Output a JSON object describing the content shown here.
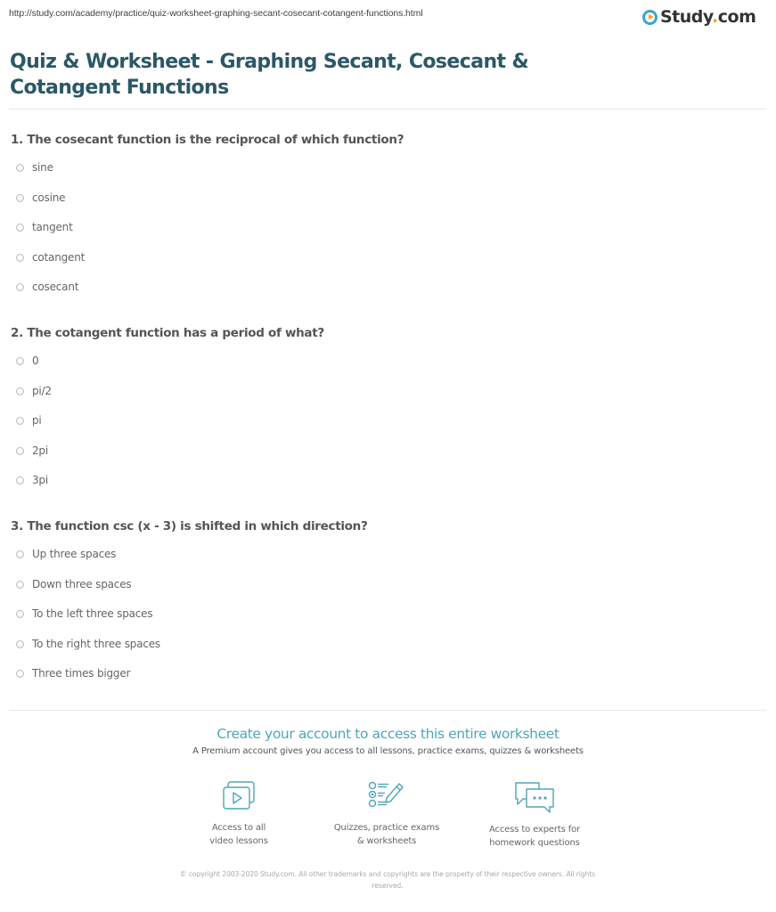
{
  "page": {
    "url": "http://study.com/academy/practice/quiz-worksheet-graphing-secant-cosecant-cotangent-functions.html",
    "logo": {
      "text_main": "Study",
      "text_dot": ".",
      "text_tld": "com",
      "icon": "play-circle-icon",
      "colors": {
        "ring": "#3ba3d0",
        "play": "#f5a623",
        "text": "#333333"
      }
    },
    "title_line1": "Quiz & Worksheet - Graphing Secant, Cosecant &",
    "title_line2": "Cotangent Functions",
    "title_color": "#2b5866"
  },
  "questions": [
    {
      "number": "1.",
      "text": "1. The cosecant function is the reciprocal of which function?",
      "options": [
        "sine",
        "cosine",
        "tangent",
        "cotangent",
        "cosecant"
      ]
    },
    {
      "number": "2.",
      "text": "2. The cotangent function has a period of what?",
      "options": [
        "0",
        "pi/2",
        "pi",
        "2pi",
        "3pi"
      ]
    },
    {
      "number": "3.",
      "text": "3. The function csc (x - 3) is shifted in which direction?",
      "options": [
        "Up three spaces",
        "Down three spaces",
        "To the left three spaces",
        "To the right three spaces",
        "Three times bigger"
      ]
    }
  ],
  "cta": {
    "title": "Create your account to access this entire worksheet",
    "subtitle": "A Premium account gives you access to all lessons, practice exams, quizzes & worksheets",
    "accent_color": "#4ea6b8",
    "features": [
      {
        "icon": "video-lessons-icon",
        "line1": "Access to all",
        "line2": "video lessons"
      },
      {
        "icon": "quiz-checklist-icon",
        "line1": "Quizzes, practice exams",
        "line2": "& worksheets"
      },
      {
        "icon": "chat-bubbles-icon",
        "line1": "Access to experts for",
        "line2": "homework questions"
      }
    ]
  },
  "footer": {
    "copyright_line1": "© copyright 2003-2020 Study.com. All other trademarks and copyrights are the property of their respective owners. All rights",
    "copyright_line2": "reserved."
  }
}
